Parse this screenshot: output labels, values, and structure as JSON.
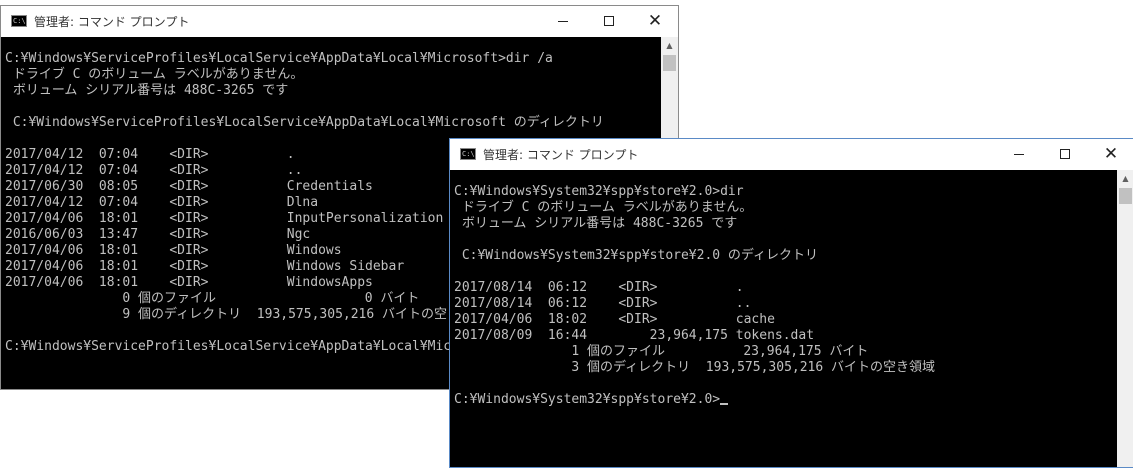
{
  "windows": [
    {
      "id": "w1",
      "title": "管理者: コマンド プロンプト",
      "icon_text": "C:\\",
      "icon": "console-app-icon",
      "lines": [
        "C:¥Windows¥ServiceProfiles¥LocalService¥AppData¥Local¥Microsoft>dir /a",
        " ドライブ C のボリューム ラベルがありません。",
        " ボリューム シリアル番号は 488C-3265 です",
        "",
        " C:¥Windows¥ServiceProfiles¥LocalService¥AppData¥Local¥Microsoft のディレクトリ",
        "",
        "2017/04/12  07:04    <DIR>          .",
        "2017/04/12  07:04    <DIR>          ..",
        "2017/06/30  08:05    <DIR>          Credentials",
        "2017/04/12  07:04    <DIR>          Dlna",
        "2017/04/06  18:01    <DIR>          InputPersonalization",
        "2016/06/03  13:47    <DIR>          Ngc",
        "2017/04/06  18:01    <DIR>          Windows",
        "2017/04/06  18:01    <DIR>          Windows Sidebar",
        "2017/04/06  18:01    <DIR>          WindowsApps",
        "               0 個のファイル                   0 バイト",
        "               9 個のディレクトリ  193,575,305,216 バイトの空き領域",
        "",
        "C:¥Windows¥ServiceProfiles¥LocalService¥AppData¥Local¥Microsoft>"
      ]
    },
    {
      "id": "w2",
      "title": "管理者: コマンド プロンプト",
      "icon_text": "C:\\",
      "icon": "console-app-icon",
      "lines": [
        "C:¥Windows¥System32¥spp¥store¥2.0>dir",
        " ドライブ C のボリューム ラベルがありません。",
        " ボリューム シリアル番号は 488C-3265 です",
        "",
        " C:¥Windows¥System32¥spp¥store¥2.0 のディレクトリ",
        "",
        "2017/08/14  06:12    <DIR>          .",
        "2017/08/14  06:12    <DIR>          ..",
        "2017/04/06  18:02    <DIR>          cache",
        "2017/08/09  16:44        23,964,175 tokens.dat",
        "               1 個のファイル          23,964,175 バイト",
        "               3 個のディレクトリ  193,575,305,216 バイトの空き領域",
        "",
        "C:¥Windows¥System32¥spp¥store¥2.0>"
      ]
    }
  ],
  "controls": {
    "minimize_icon": "minimize-icon",
    "maximize_icon": "maximize-icon",
    "close_icon": "close-icon",
    "close_glyph": "✕"
  },
  "colors": {
    "console_bg": "#000000",
    "console_fg": "#c0c0c0",
    "active_border": "#5a8ac6"
  }
}
